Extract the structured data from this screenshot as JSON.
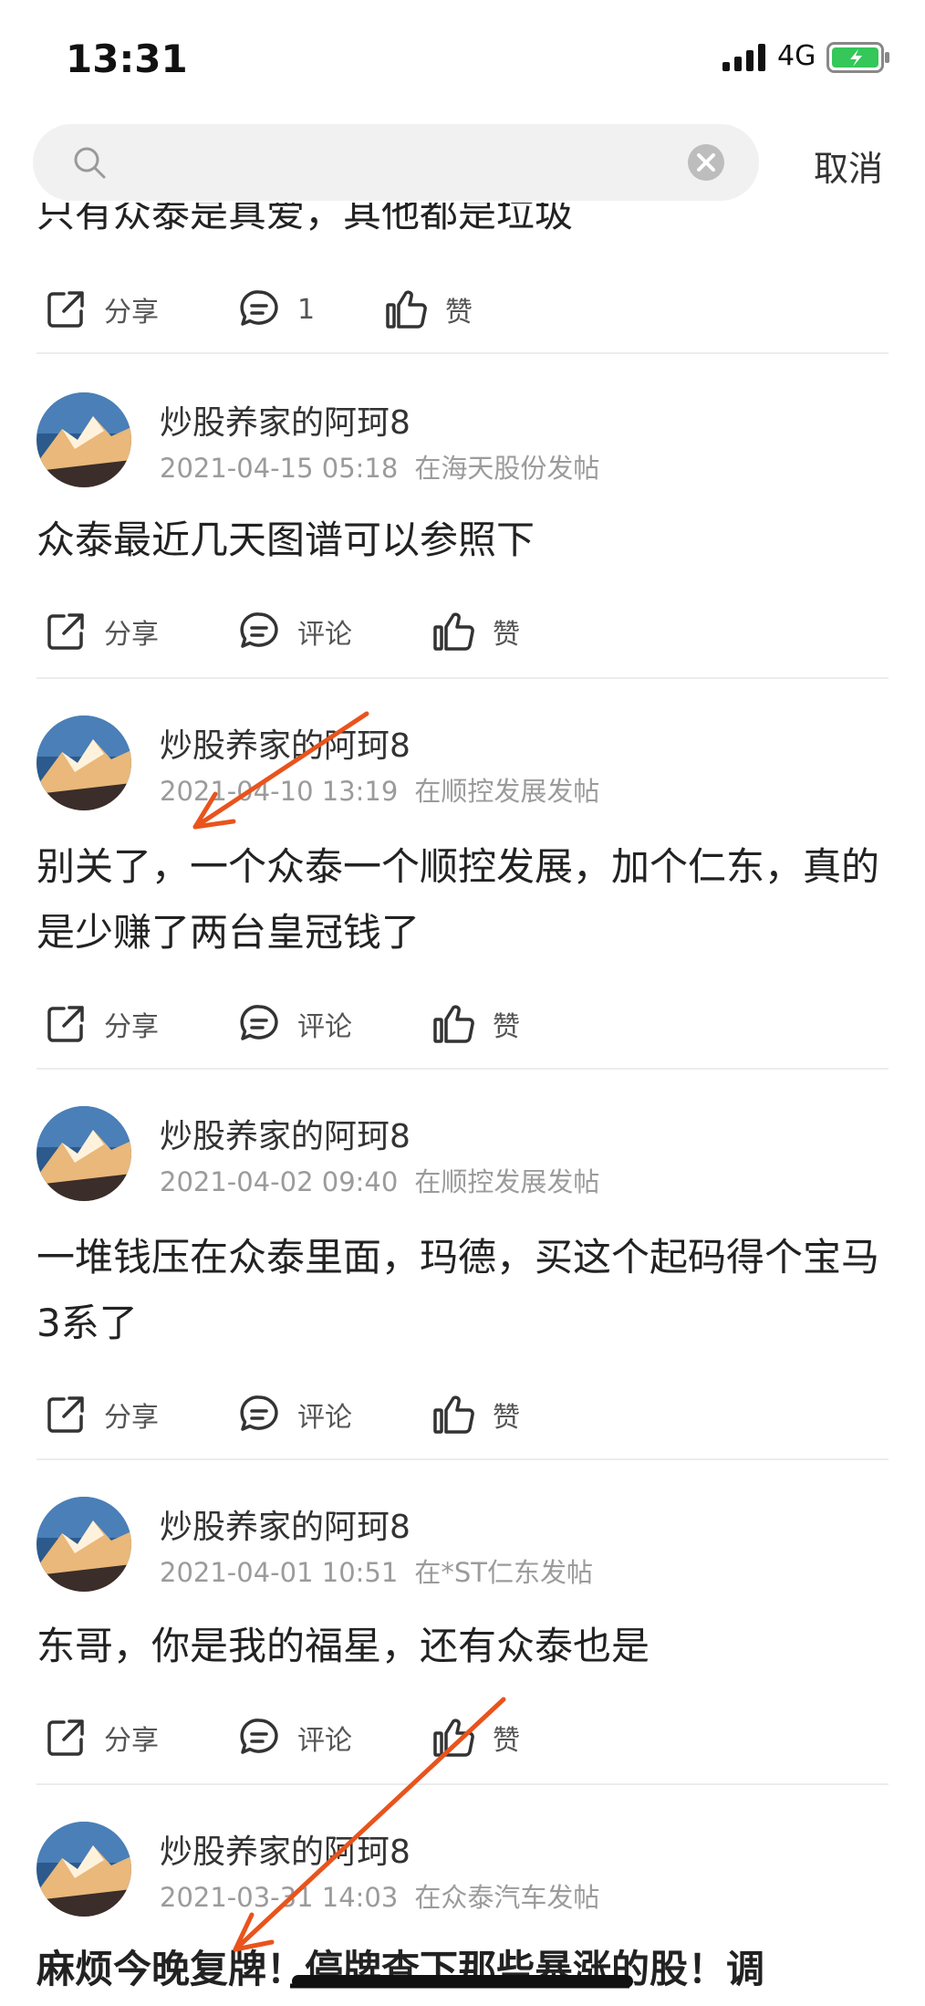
{
  "status_bar": {
    "time": "13:31",
    "network": "4G"
  },
  "search": {
    "placeholder": "",
    "cancel_label": "取消"
  },
  "top_partial": {
    "content": "只有众泰是真爱，其他都是垃圾",
    "share_label": "分享",
    "comment_label": "1",
    "like_label": "赞"
  },
  "posts": [
    {
      "author": "炒股养家的阿珂8",
      "datetime": "2021-04-15 05:18",
      "location": "在海天股份发帖",
      "content": "众泰最近几天图谱可以参照下",
      "share_label": "分享",
      "comment_label": "评论",
      "like_label": "赞"
    },
    {
      "author": "炒股养家的阿珂8",
      "datetime": "2021-04-10 13:19",
      "location": "在顺控发展发帖",
      "content": "别关了，一个众泰一个顺控发展，加个仁东，真的是少赚了两台皇冠钱了",
      "share_label": "分享",
      "comment_label": "评论",
      "like_label": "赞"
    },
    {
      "author": "炒股养家的阿珂8",
      "datetime": "2021-04-02 09:40",
      "location": "在顺控发展发帖",
      "content": "一堆钱压在众泰里面，玛德，买这个起码得个宝马3系了",
      "share_label": "分享",
      "comment_label": "评论",
      "like_label": "赞"
    },
    {
      "author": "炒股养家的阿珂8",
      "datetime": "2021-04-01 10:51",
      "location": "在*ST仁东发帖",
      "content": "东哥，你是我的福星，还有众泰也是",
      "share_label": "分享",
      "comment_label": "评论",
      "like_label": "赞"
    },
    {
      "author": "炒股养家的阿珂8",
      "datetime": "2021-03-31 14:03",
      "location": "在众泰汽车发帖",
      "content": "麻烦今晚复牌！停牌查下那些暴涨的股！调",
      "share_label": "分享",
      "comment_label": "评论",
      "like_label": "赞"
    }
  ],
  "colors": {
    "arrow": "#e8541c",
    "meta": "#9b9b9b",
    "battery": "#35c759"
  }
}
